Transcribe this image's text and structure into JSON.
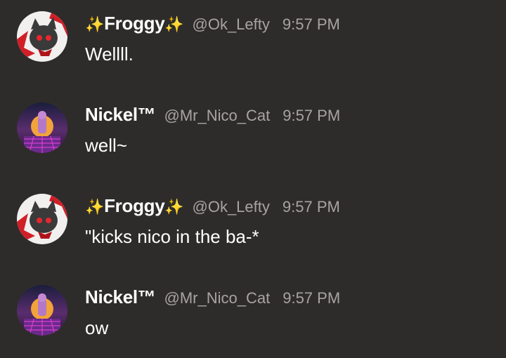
{
  "messages": [
    {
      "name": "Froggy",
      "name_prefix": "✨",
      "name_suffix": "✨",
      "handle": "@Ok_Lefty",
      "time": "9:57 PM",
      "text": "Wellll.",
      "avatar_icon": "froggy-avatar-icon"
    },
    {
      "name": "Nickel™",
      "name_prefix": "",
      "name_suffix": "",
      "handle": "@Mr_Nico_Cat",
      "time": "9:57 PM",
      "text": "well~",
      "avatar_icon": "nickel-avatar-icon"
    },
    {
      "name": "Froggy",
      "name_prefix": "✨",
      "name_suffix": "✨",
      "handle": "@Ok_Lefty",
      "time": "9:57 PM",
      "text": "\"kicks nico in the ba-*",
      "avatar_icon": "froggy-avatar-icon"
    },
    {
      "name": "Nickel™",
      "name_prefix": "",
      "name_suffix": "",
      "handle": "@Mr_Nico_Cat",
      "time": "9:57 PM",
      "text": "ow",
      "avatar_icon": "nickel-avatar-icon"
    }
  ],
  "colors": {
    "background": "#2e2c2a",
    "name": "#ffffff",
    "meta": "#a7a4a0",
    "sparkle": "#f8d93b"
  }
}
